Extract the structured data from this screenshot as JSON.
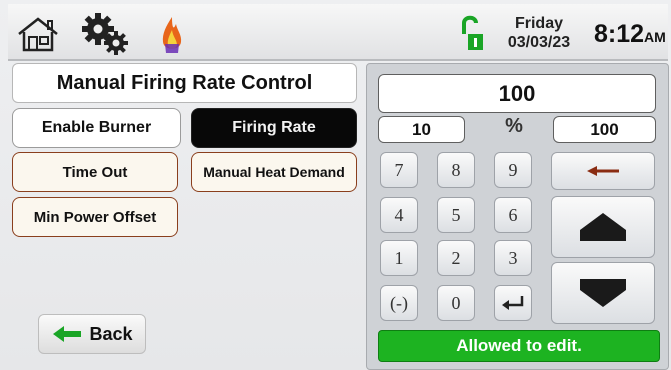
{
  "header": {
    "day": "Friday",
    "date": "03/03/23",
    "time": "8:12",
    "ampm": "AM",
    "icons": [
      "home-icon",
      "gear-icon",
      "flame-icon",
      "unlock-icon"
    ]
  },
  "left": {
    "title": "Manual Firing Rate Control",
    "enable_burner": "Enable Burner",
    "firing_rate": "Firing Rate",
    "time_out": "Time Out",
    "manual_heat_demand": "Manual Heat Demand",
    "min_power_offset": "Min Power Offset",
    "back": "Back"
  },
  "keypad": {
    "value": "100",
    "min": "10",
    "unit": "%",
    "max": "100",
    "keys": [
      "7",
      "8",
      "9",
      "4",
      "5",
      "6",
      "1",
      "2",
      "3",
      "(-)",
      "0"
    ],
    "status": "Allowed to edit."
  },
  "colors": {
    "status_green": "#1db321",
    "selected_button": "#080808",
    "flame": "#e8651a"
  }
}
